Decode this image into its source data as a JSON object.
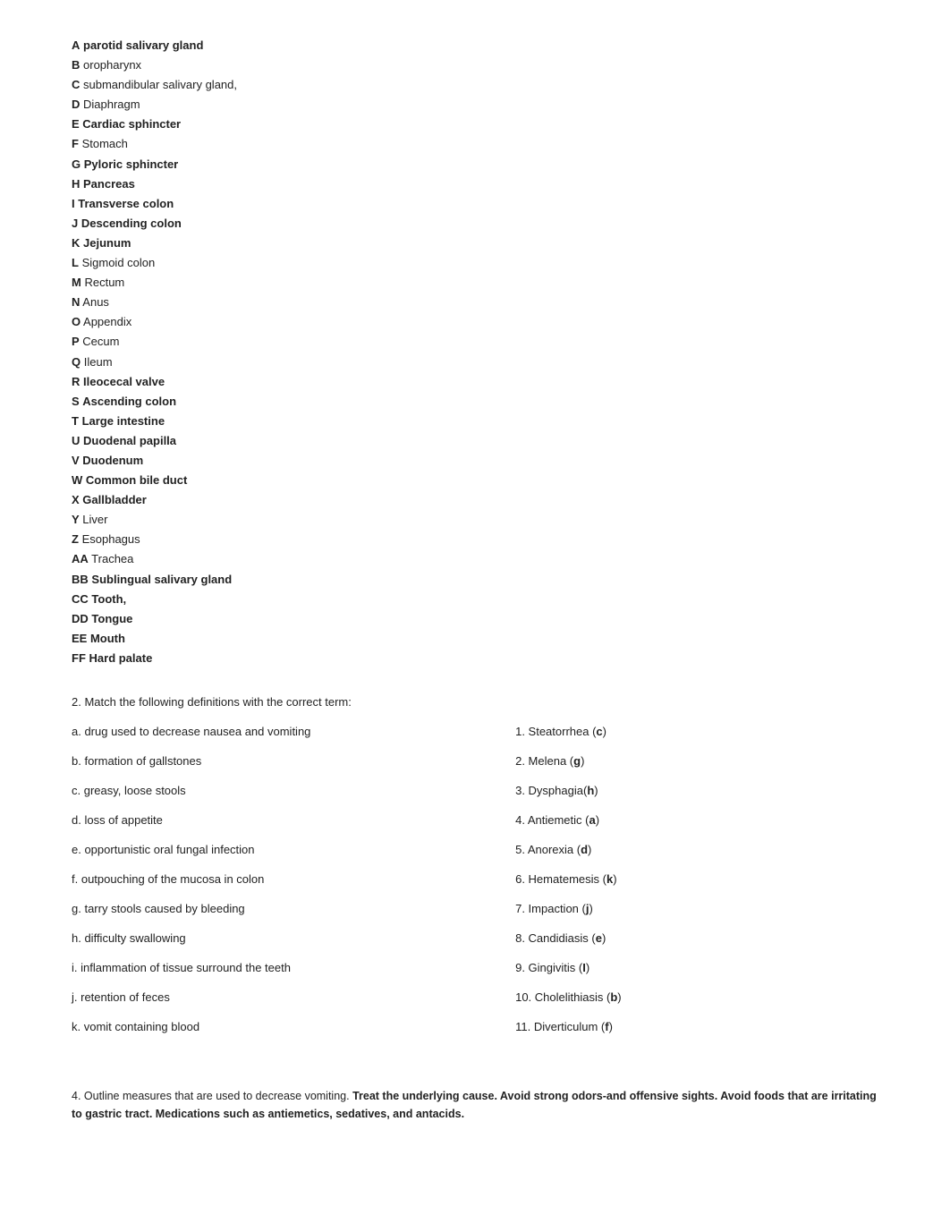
{
  "anatomy_list": [
    {
      "letter": "A",
      "label": "parotid salivary gland"
    },
    {
      "letter": "B",
      "label": "oropharynx"
    },
    {
      "letter": "C",
      "label": "submandibular salivary gland,"
    },
    {
      "letter": "D",
      "label": "Diaphragm"
    },
    {
      "letter": "E",
      "label": "Cardiac sphincter"
    },
    {
      "letter": "F",
      "label": "Stomach"
    },
    {
      "letter": "G",
      "label": "Pyloric sphincter"
    },
    {
      "letter": "H",
      "label": "Pancreas"
    },
    {
      "letter": "I",
      "label": "Transverse colon"
    },
    {
      "letter": "J",
      "label": "Descending colon"
    },
    {
      "letter": "K",
      "label": "Jejunum"
    },
    {
      "letter": "L",
      "label": "Sigmoid colon"
    },
    {
      "letter": "M",
      "label": "Rectum"
    },
    {
      "letter": "N",
      "label": "Anus"
    },
    {
      "letter": "O",
      "label": "Appendix"
    },
    {
      "letter": "P",
      "label": "Cecum"
    },
    {
      "letter": "Q",
      "label": "Ileum"
    },
    {
      "letter": "R",
      "label": "Ileocecal valve"
    },
    {
      "letter": "S",
      "label": "Ascending colon"
    },
    {
      "letter": "T",
      "label": "Large intestine"
    },
    {
      "letter": "U",
      "label": "Duodenal papilla"
    },
    {
      "letter": "V",
      "label": "Duodenum"
    },
    {
      "letter": "W",
      "label": "Common bile duct"
    },
    {
      "letter": "X",
      "label": "Gallbladder"
    },
    {
      "letter": "Y",
      "label": "Liver"
    },
    {
      "letter": "Z",
      "label": "Esophagus"
    },
    {
      "letter": "AA",
      "label": "Trachea"
    },
    {
      "letter": "BB",
      "label": "Sublingual salivary gland"
    },
    {
      "letter": "CC",
      "label": "Tooth,"
    },
    {
      "letter": "DD",
      "label": "Tongue"
    },
    {
      "letter": "EE",
      "label": "Mouth"
    },
    {
      "letter": "FF",
      "label": "Hard palate"
    }
  ],
  "section2_title": "2. Match the following definitions with the correct term:",
  "match_items": [
    {
      "left": "a. drug used to decrease nausea and vomiting",
      "right": "1. Steatorrhea (c)"
    },
    {
      "left": "b. formation of gallstones",
      "right": "2. Melena (g)"
    },
    {
      "left": "c. greasy, loose stools",
      "right": "3. Dysphagia(h)"
    },
    {
      "left": "d. loss of appetite",
      "right": "4. Antiemetic (a)"
    },
    {
      "left": "e. opportunistic oral fungal infection",
      "right": "5. Anorexia (d)"
    },
    {
      "left": "f. outpouching of the mucosa in colon",
      "right": "6. Hematemesis (k)"
    },
    {
      "left": "g. tarry stools caused by bleeding",
      "right": "7. Impaction (j)"
    },
    {
      "left": "h. difficulty swallowing",
      "right": "8. Candidiasis (e)"
    },
    {
      "left": "i. inflammation of tissue surround the teeth",
      "right": "9. Gingivitis (I)"
    },
    {
      "left": "j. retention of feces",
      "right": "10. Cholelithiasis (b)"
    },
    {
      "left": "k. vomit containing blood",
      "right": "11. Diverticulum (f)"
    }
  ],
  "footer": {
    "prefix": "4. Outline measures that are used to decrease vomiting. ",
    "bold": "Treat the underlying cause. Avoid strong odors-and offensive sights. Avoid foods that are irritating to gastric tract. Medications such as antiemetics, sedatives, and antacids."
  }
}
